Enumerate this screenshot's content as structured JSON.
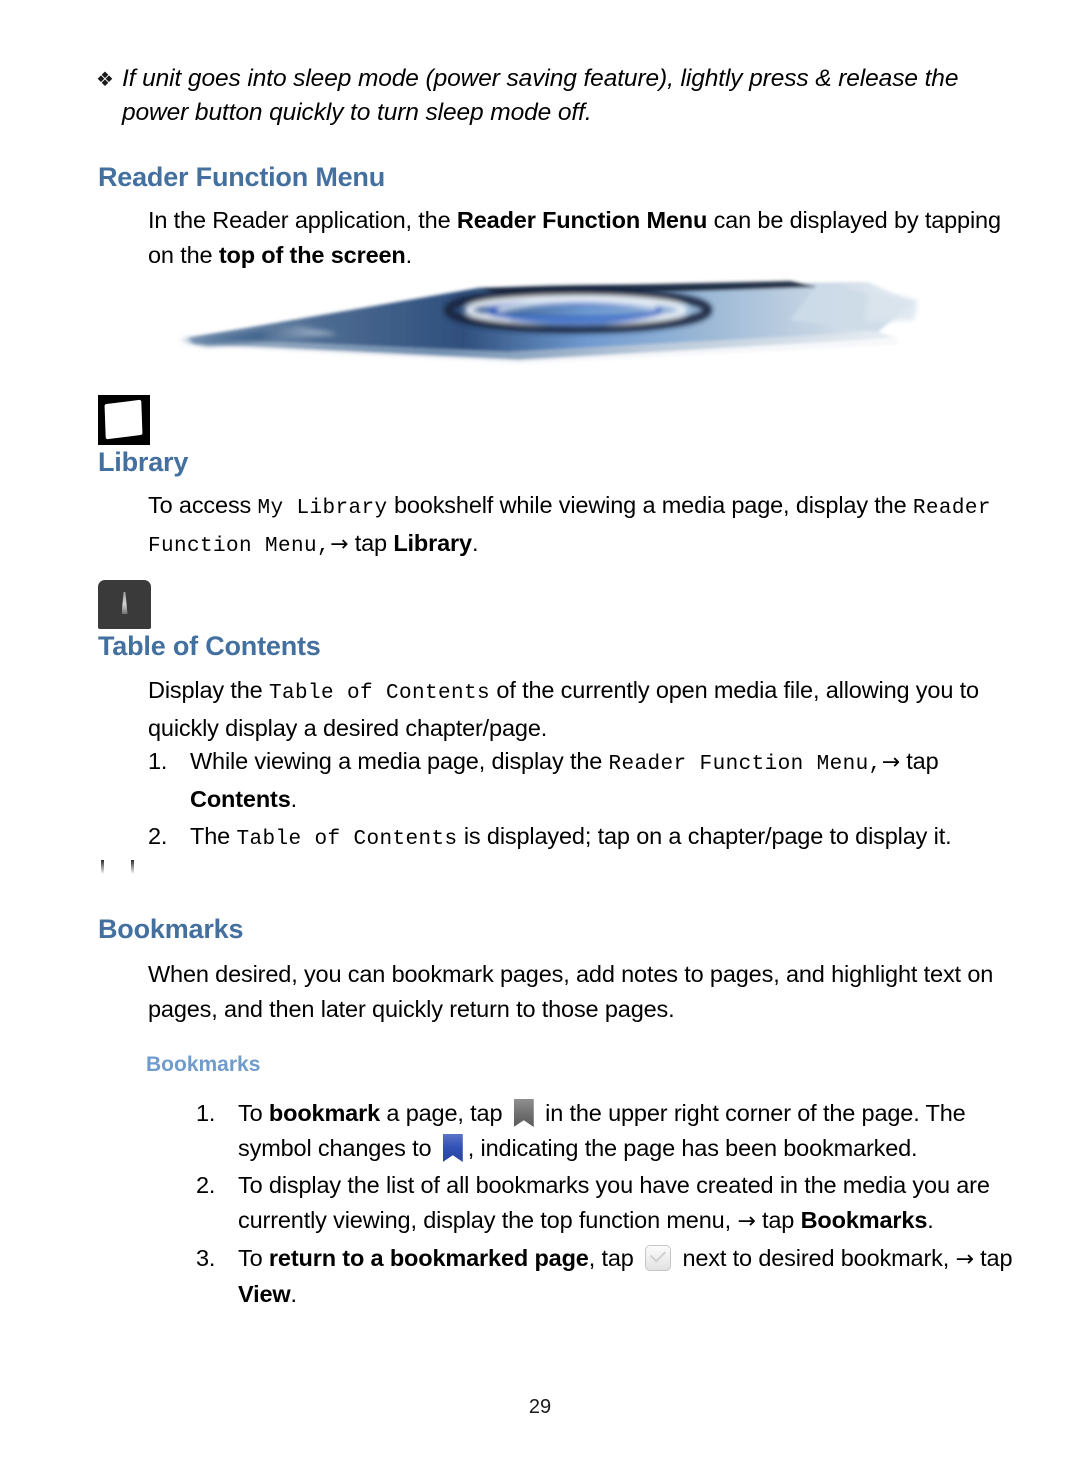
{
  "note": {
    "bullet_glyph": "❖",
    "text": "If unit goes into sleep mode (power saving feature), lightly press & release the power button quickly to turn sleep mode off."
  },
  "sections": {
    "reader_function_menu": {
      "heading": "Reader Function Menu",
      "para_part1": "In the Reader application, the ",
      "para_bold1": "Reader Function Menu",
      "para_part2": " can be displayed by tapping on the ",
      "para_bold2": "top of the screen",
      "para_part3": "."
    },
    "library": {
      "heading": "Library",
      "icon_name": "library-icon",
      "para_part1": "To access ",
      "para_mono1": "My Library",
      "para_part2": " bookshelf while viewing a media page, display the ",
      "para_mono2": "Reader Function Menu,",
      "para_arrow": "→",
      "para_part3": " tap ",
      "para_bold1": "Library",
      "para_part4": "."
    },
    "table_of_contents": {
      "heading": "Table of Contents",
      "icon_name": "table-of-contents-icon",
      "para_part1": "Display the ",
      "para_mono1": "Table of Contents",
      "para_part2": " of the currently open media file, allowing you to quickly display a desired chapter/page.",
      "items": [
        {
          "number": "1.",
          "part1": "While viewing a media page, display the ",
          "mono1": "Reader Function Menu,",
          "arrow": "→",
          "part2": " tap ",
          "bold1": "Contents",
          "part3": "."
        },
        {
          "number": "2.",
          "part1": "The ",
          "mono1": "Table of Contents",
          "part2": " is displayed; tap on a chapter/page to display it."
        }
      ]
    },
    "bookmarks": {
      "heading": "Bookmarks",
      "icon_name": "bookmark-page-icon",
      "para": "When desired, you can bookmark pages, add notes to pages, and highlight text on pages, and then later quickly return to those pages.",
      "subheading": "Bookmarks",
      "items": [
        {
          "number": "1.",
          "part1": "To ",
          "bold1": "bookmark",
          "part2": " a page, tap ",
          "icon1": "bookmark-ribbon-gray-icon",
          "part3": " in the upper right corner of the page. The symbol changes to ",
          "icon2": "bookmark-ribbon-blue-icon",
          "part4": ", indicating the page has been bookmarked."
        },
        {
          "number": "2.",
          "part1": "To display the list of all bookmarks you have created in the media you are currently viewing, display the top function menu, ",
          "arrow": "→",
          "part2": " tap ",
          "bold1": "Bookmarks",
          "part3": "."
        },
        {
          "number": "3.",
          "part1": "To ",
          "bold1": "return to a bookmarked page",
          "part2": ", tap ",
          "icon1": "checkbox-checked-icon",
          "part3": " next to desired bookmark, ",
          "arrow": "→",
          "part4": " tap ",
          "bold2": "View",
          "part5": "."
        }
      ]
    }
  },
  "device_image": {
    "name": "tablet-device-photo",
    "description": "Edge-on photo of a tablet device with blue screen"
  },
  "page_number": "29",
  "colors": {
    "heading_blue": "#44709f",
    "subheading_blue": "#6f9ccd",
    "text_black": "#000000",
    "ribbon_blue": "#3050b4",
    "ribbon_gray": "#6f6f6f"
  }
}
